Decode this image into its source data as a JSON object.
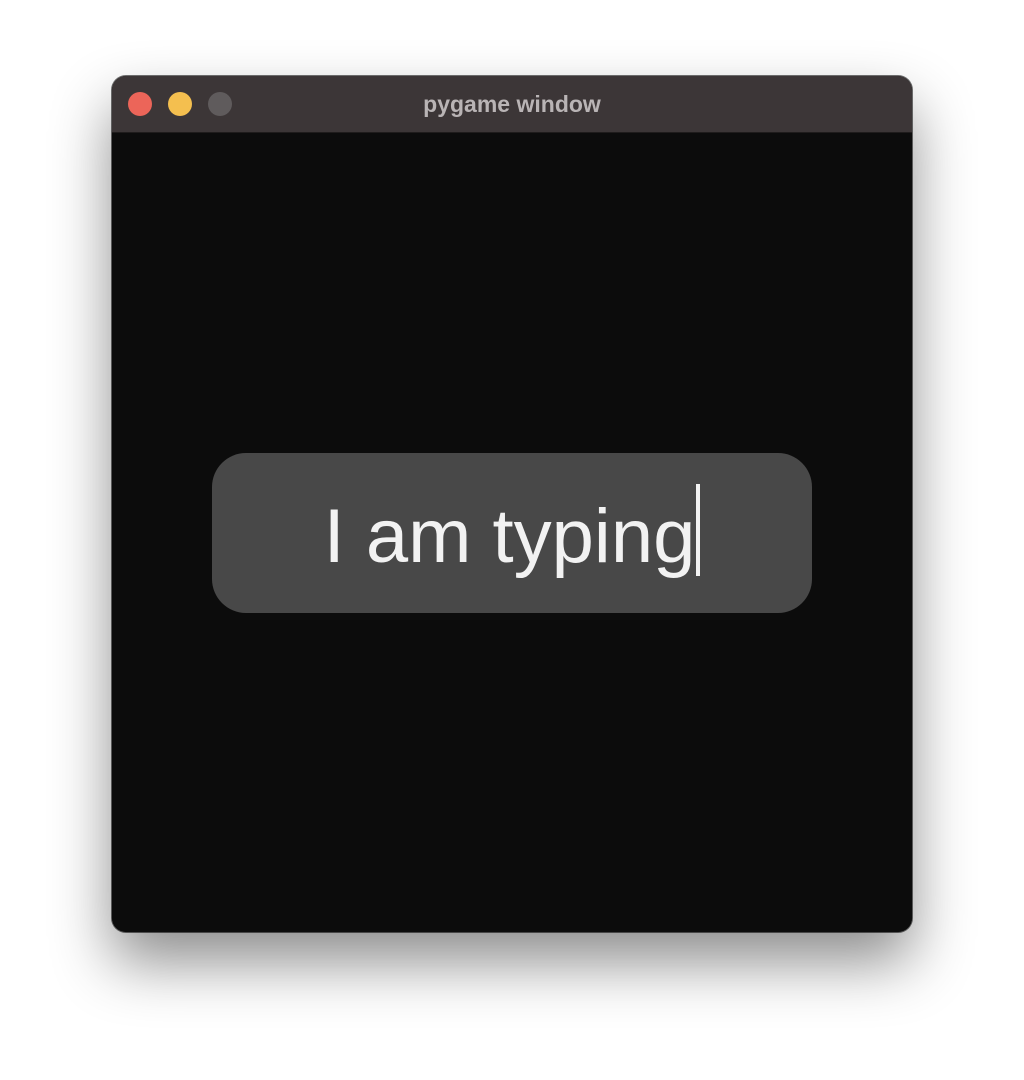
{
  "window": {
    "title": "pygame window"
  },
  "textbox": {
    "value": "I am typing"
  },
  "colors": {
    "titlebar": "#3c3637",
    "close": "#ec6559",
    "minimize": "#f4bf4f",
    "zoom": "#5f5b5c",
    "canvas": "#0c0c0c",
    "textbox_bg": "#484848",
    "text": "#f2f2f2",
    "caret": "#f2f2f2"
  }
}
